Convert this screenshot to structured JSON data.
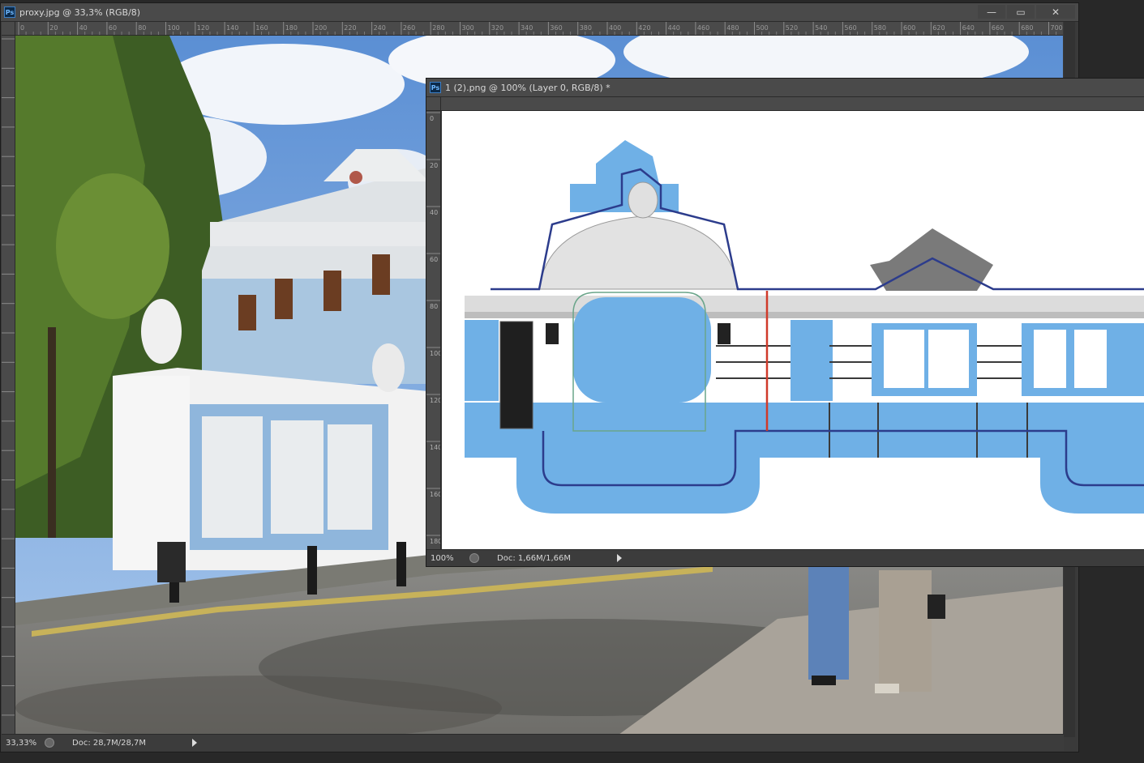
{
  "window1": {
    "title": "proxy.jpg @ 33,3% (RGB/8)",
    "zoom": "33,33%",
    "doc": "Doc: 28,7M/28,7M",
    "controls": {
      "minimize": "—",
      "restore": "▭",
      "close": "✕"
    },
    "ruler_labels": [
      "0",
      "20",
      "40",
      "60",
      "80",
      "100",
      "120",
      "140",
      "160",
      "180",
      "200",
      "220",
      "240",
      "260",
      "280",
      "300",
      "320",
      "340",
      "360",
      "380",
      "400",
      "420",
      "440",
      "460",
      "480",
      "500",
      "520",
      "540",
      "560",
      "580",
      "600",
      "620",
      "640",
      "660",
      "680",
      "700"
    ]
  },
  "window2": {
    "title": "1 (2).png @ 100% (Layer 0, RGB/8) *",
    "zoom": "100%",
    "doc": "Doc: 1,66M/1,66M",
    "ruler_v_labels": [
      "0",
      "20",
      "40",
      "60",
      "80",
      "100",
      "120",
      "140",
      "160",
      "180"
    ]
  },
  "icons": {
    "app": "photoshop-icon",
    "status": "status-menu-icon",
    "arrow": "play-arrow-icon"
  },
  "colors": {
    "facade_blue": "#6fb0e6",
    "outline_blue": "#2c3c8c",
    "guide_red": "#d03a2a",
    "panel_dark": "#3a3a3a"
  }
}
